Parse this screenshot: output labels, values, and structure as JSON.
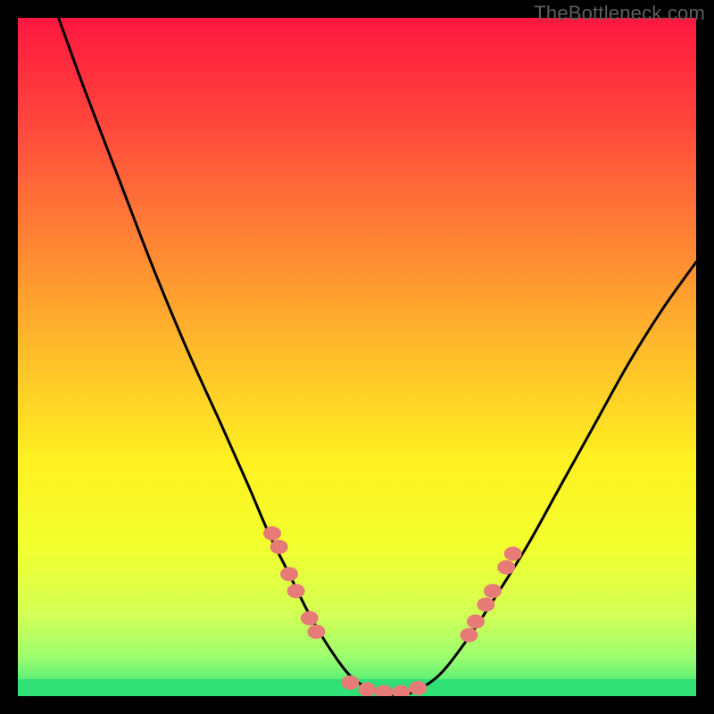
{
  "watermark": "TheBottleneck.com",
  "chart_data": {
    "type": "line",
    "title": "",
    "xlabel": "",
    "ylabel": "",
    "xlim": [
      0,
      100
    ],
    "ylim": [
      0,
      100
    ],
    "series": [
      {
        "name": "curve",
        "x": [
          6,
          10,
          15,
          20,
          25,
          30,
          34,
          37,
          40,
          43,
          46,
          49,
          52,
          55,
          58,
          62,
          66,
          70,
          75,
          80,
          85,
          90,
          95,
          100
        ],
        "y": [
          100,
          89,
          76,
          63,
          51,
          40,
          31,
          24,
          18,
          12,
          7,
          3,
          1,
          0,
          0.5,
          3,
          8,
          14,
          22,
          31,
          40,
          49,
          57,
          64
        ]
      }
    ],
    "green_band_y": 2.5,
    "markers": [
      {
        "x": 37.5,
        "y": 24
      },
      {
        "x": 38.5,
        "y": 22
      },
      {
        "x": 40.0,
        "y": 18
      },
      {
        "x": 41.0,
        "y": 15.5
      },
      {
        "x": 43.0,
        "y": 11.5
      },
      {
        "x": 44.0,
        "y": 9.5
      },
      {
        "x": 49.0,
        "y": 2.0
      },
      {
        "x": 51.5,
        "y": 1.0
      },
      {
        "x": 54.0,
        "y": 0.6
      },
      {
        "x": 56.5,
        "y": 0.6
      },
      {
        "x": 59.0,
        "y": 1.2
      },
      {
        "x": 66.5,
        "y": 9.0
      },
      {
        "x": 67.5,
        "y": 11.0
      },
      {
        "x": 69.0,
        "y": 13.5
      },
      {
        "x": 70.0,
        "y": 15.5
      },
      {
        "x": 72.0,
        "y": 19.0
      },
      {
        "x": 73.0,
        "y": 21.0
      }
    ]
  }
}
